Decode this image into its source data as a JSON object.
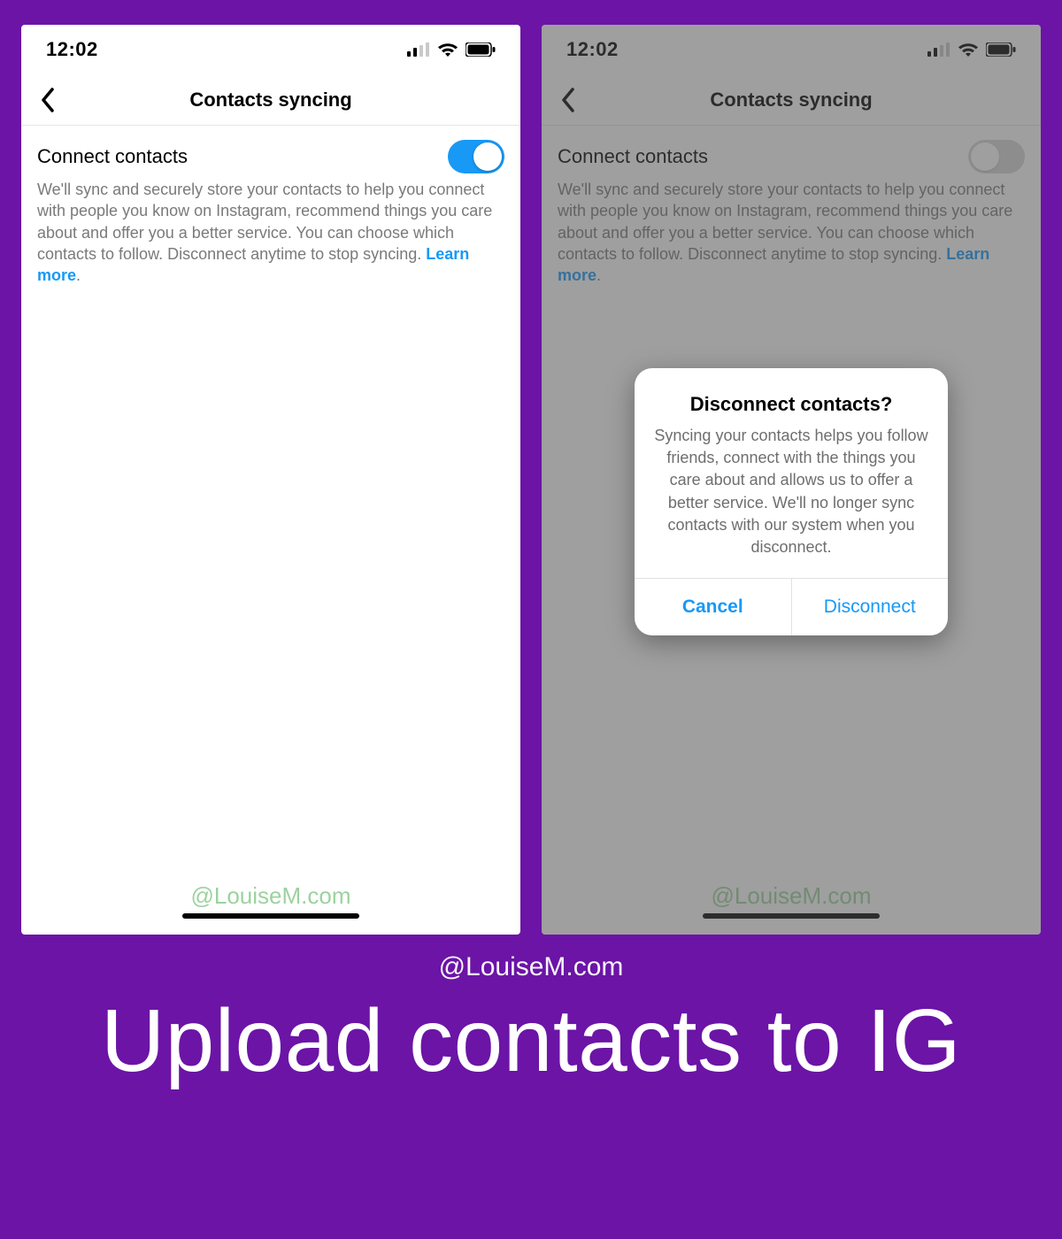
{
  "colors": {
    "background": "#6b14a6",
    "iosBlue": "#1899f5",
    "watermarkGreen": "#4caf50"
  },
  "caption": {
    "watermark": "@LouiseM.com",
    "headline": "Upload contacts to IG"
  },
  "statusBar": {
    "time": "12:02"
  },
  "screenLeft": {
    "header": {
      "title": "Contacts syncing"
    },
    "setting": {
      "title": "Connect contacts",
      "description": "We'll sync and securely store your contacts to help you connect with people you know on Instagram, recommend things you care about and offer you a better service. You can choose which contacts to follow. Disconnect anytime to stop syncing. ",
      "learnMore": "Learn more",
      "period": ".",
      "toggleOn": true
    },
    "watermark": "@LouiseM.com"
  },
  "screenRight": {
    "header": {
      "title": "Contacts syncing"
    },
    "setting": {
      "title": "Connect contacts",
      "description": "We'll sync and securely store your contacts to help you connect with people you know on Instagram, recommend things you care about and offer you a better service. You can choose which contacts to follow. Disconnect anytime to stop syncing. ",
      "learnMore": "Learn more",
      "period": ".",
      "toggleOn": false
    },
    "dialog": {
      "title": "Disconnect contacts?",
      "body": "Syncing your contacts helps you follow friends, connect with the things you care about and allows us to offer a better service. We'll no longer sync contacts with our system when you disconnect.",
      "cancel": "Cancel",
      "confirm": "Disconnect"
    },
    "watermark": "@LouiseM.com"
  }
}
